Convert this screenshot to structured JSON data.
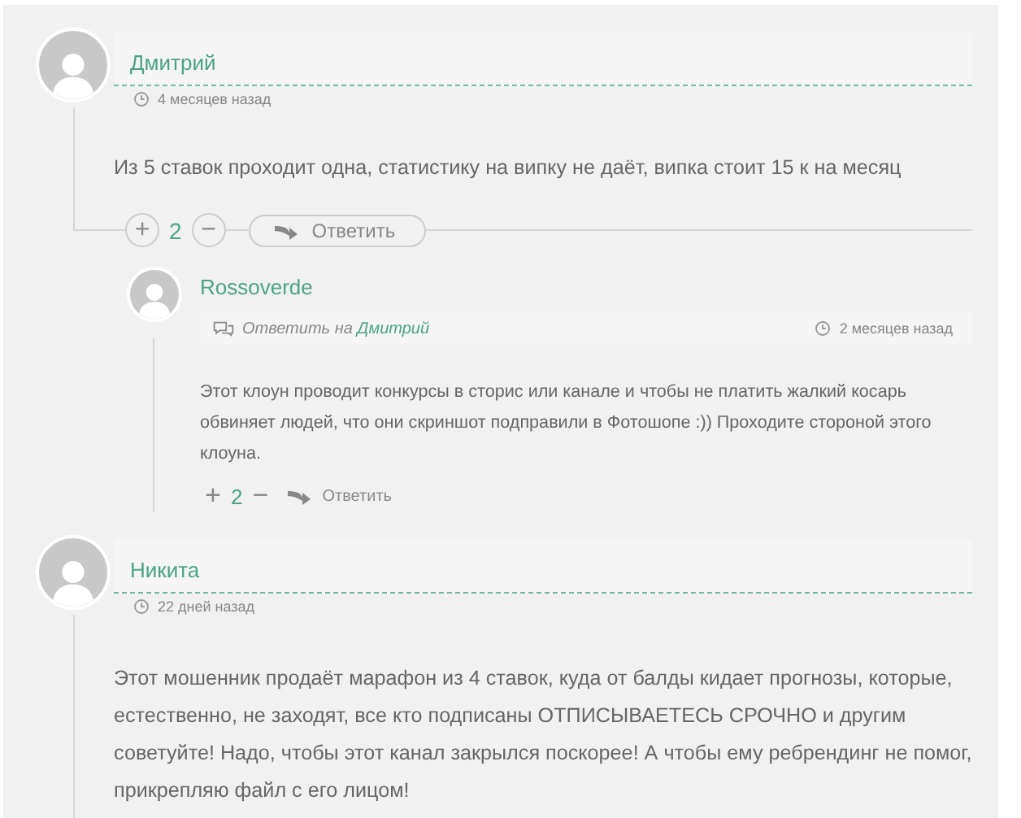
{
  "comments": [
    {
      "kind": "comment",
      "author": "Дмитрий",
      "time": "4 месяцев назад",
      "text": "Из 5 ставок проходит одна, статистику на випку не даёт, випка стоит 15 к на месяц",
      "actions": {
        "plus": "+",
        "count": "2",
        "minus": "−",
        "reply": "Ответить"
      },
      "children": [
        {
          "kind": "reply",
          "author": "Rossoverde",
          "reply_to_label": "Ответить на",
          "reply_to": "Дмитрий",
          "time": "2 месяцев назад",
          "text": "Этот клоун проводит конкурсы в сторис или канале и чтобы не платить жалкий косарь обвиняет людей, что они скриншот подправили в Фотошопе :)) Проходите стороной этого клоуна.",
          "actions": {
            "plus": "+",
            "count": "2",
            "minus": "−",
            "reply": "Ответить"
          }
        }
      ]
    },
    {
      "kind": "comment",
      "author": "Никита",
      "time": "22 дней назад",
      "text": "Этот мошенник продаёт марафон из 4 ставок, куда от балды кидает прогнозы, которые, естественно, не заходят, все кто подписаны ОТПИСЫВАЕТЕСЬ СРОЧНО и другим советуйте! Надо, чтобы этот канал закрылся поскорее! А чтобы ему ребрендинг не помог, прикрепляю файл с его лицом!"
    }
  ]
}
